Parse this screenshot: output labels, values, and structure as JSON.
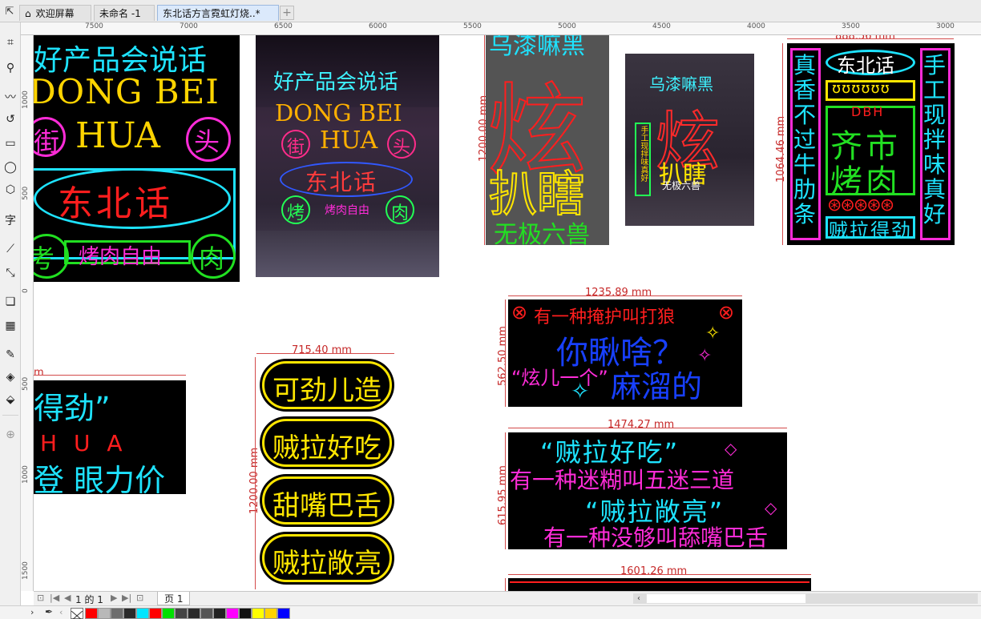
{
  "tabs": {
    "welcome": "欢迎屏幕",
    "untitled": "未命名 -1",
    "document": "东北话方言霓虹灯烧..*",
    "add": "+"
  },
  "ruler": {
    "top_ticks": [
      "7500",
      "7000",
      "6500",
      "6000",
      "5500",
      "5000",
      "4500",
      "4000",
      "3500",
      "3000"
    ],
    "left_ticks": [
      "1000",
      "500",
      "0",
      "500",
      "1000",
      "1500"
    ]
  },
  "artboards": {
    "a1": {
      "line1": "好产品会说话",
      "line2": "DONG BEI",
      "left_char": "街",
      "line3": "HUA",
      "right_char": "头",
      "line4": "东北话",
      "left_char2": "考",
      "line5": "烤肉自由",
      "right_char2": "肉"
    },
    "a2": {
      "line1": "好产品会说话",
      "line2": "DONG BEI",
      "left_char": "街",
      "line3": "HUA",
      "right_char": "头",
      "line4": "东北话",
      "left_char2": "烤",
      "line5": "烤肉自由",
      "right_char2": "肉"
    },
    "a3": {
      "top": "乌漆嘛黑",
      "big": "炫",
      "mid": "扒瞎",
      "bottom": "无极六兽",
      "dim": "1200.00 mm"
    },
    "a4": {
      "top": "乌漆嘛黑",
      "big": "炫",
      "mid": "扒瞎",
      "bottom": "无极六兽",
      "side": "手工现拌味真好"
    },
    "a5": {
      "dim_top": "888.56 mm",
      "dim_left": "1064.46 mm",
      "left_col": "真香不过牛肋条",
      "right_col": "手工现拌味真好",
      "title": "东北话",
      "brand": "DBH",
      "center1": "齐市",
      "center2": "烤肉",
      "bottom": "贼拉得劲"
    },
    "a6": {
      "dim_top": "1235.89 mm",
      "dim_left": "562.50 mm",
      "line1": "有一种掩护叫打狼",
      "line2": "你瞅啥？",
      "line3a": "“炫儿一个”",
      "line3b": "麻溜的"
    },
    "a7": {
      "dim_top": "1474.27 mm",
      "dim_left": "615.95 mm",
      "line1": "“贼拉好吃”",
      "line2": "有一种迷糊叫五迷三道",
      "line3": "“贼拉敞亮”",
      "line4": "有一种没够叫舔嘴巴舌"
    },
    "a8": {
      "dim_top": "1601.26 mm"
    },
    "a9": {
      "dim_top": "715.40 mm",
      "dim_left": "1200.00 mm",
      "items": [
        "可劲儿造",
        "贼拉好吃",
        "甜嘴巴舌",
        "贼拉敞亮"
      ]
    },
    "a10": {
      "line1": "得劲”",
      "line2": "H U A",
      "line3": "登 眼力价",
      "dim_top": "m"
    }
  },
  "pagebar": {
    "page_count": "1 的 1",
    "page_tab": "页 1"
  },
  "palette": {
    "colors": [
      "#ff0000",
      "#b8b8b8",
      "#6e6e6e",
      "#2a2a2a",
      "#00e5ff",
      "#ff0000",
      "#00e000",
      "#444444",
      "#2b2b2b",
      "#555555",
      "#222222",
      "#ff00ff",
      "#111111",
      "#ffff00",
      "#ffd400",
      "#0000ff"
    ]
  }
}
